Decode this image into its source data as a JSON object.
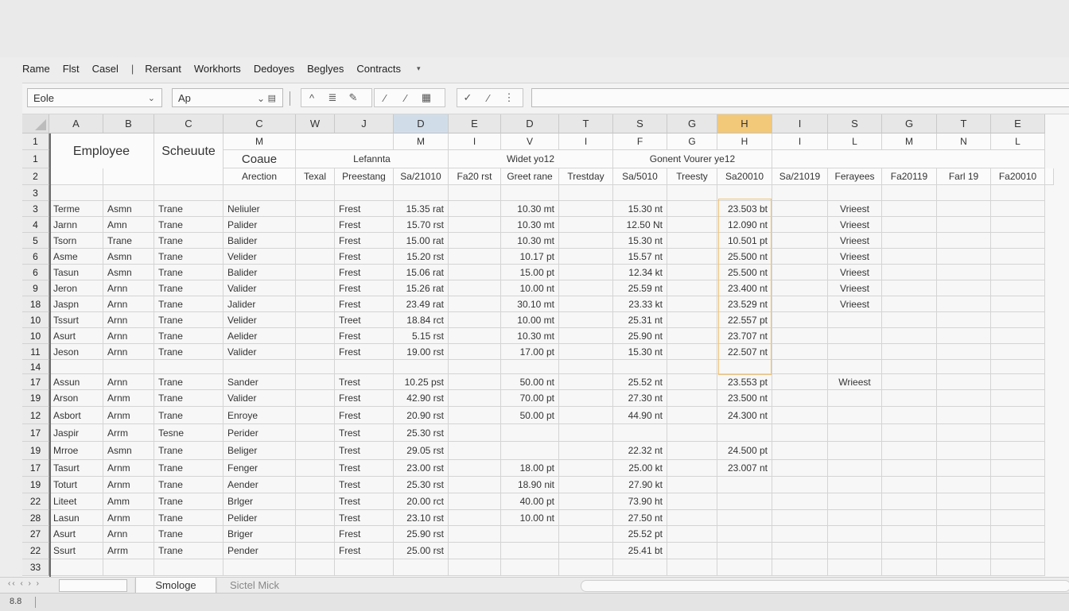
{
  "menu": [
    "Rame",
    "Flst",
    "Casel",
    "|",
    "Rersant",
    "Workhorts",
    "Dedoyes",
    "Beglyes",
    "Contracts"
  ],
  "toolbar": {
    "name_box": "Eole",
    "font_box": "Ap",
    "group1": [
      "^",
      "≣",
      "✎"
    ],
    "group2": [
      "⁄",
      "⁄",
      "▦"
    ],
    "group3": [
      "✓",
      "⁄",
      "⋮"
    ]
  },
  "columns": [
    {
      "label": "A",
      "w": 68
    },
    {
      "label": "B",
      "w": 64
    },
    {
      "label": "C",
      "w": 87
    },
    {
      "label": "C",
      "w": 91
    },
    {
      "label": "W",
      "w": 49
    },
    {
      "label": "J",
      "w": 74
    },
    {
      "label": "D",
      "w": 69
    },
    {
      "label": "E",
      "w": 66
    },
    {
      "label": "D",
      "w": 73
    },
    {
      "label": "T",
      "w": 68
    },
    {
      "label": "S",
      "w": 68
    },
    {
      "label": "G",
      "w": 63
    },
    {
      "label": "H",
      "w": 69
    },
    {
      "label": "I",
      "w": 70
    },
    {
      "label": "S",
      "w": 68
    },
    {
      "label": "G",
      "w": 69
    },
    {
      "label": "T",
      "w": 68
    },
    {
      "label": "E",
      "w": 68
    }
  ],
  "row_numbers": [
    "1",
    "1",
    "2",
    "3",
    "3",
    "4",
    "5",
    "6",
    "6",
    "9",
    "18",
    "10",
    "10",
    "11",
    "14",
    "17",
    "19",
    "12",
    "17",
    "19",
    "17",
    "19",
    "22",
    "28",
    "27",
    "22",
    "33"
  ],
  "header": {
    "row1": {
      "d": "M",
      "g": "M",
      "j": "I",
      "k": "V",
      "l": "I",
      "m": "F",
      "n": "G",
      "o": "H",
      "p": "I",
      "q": "L",
      "r": "M",
      "s": "N",
      "t": "L"
    },
    "employee": "Employee",
    "scheuute": "Scheuute",
    "coaue": "Coaue",
    "lefannta": "Lefannta",
    "widet": "Widet yo12",
    "gonent": "Gonent Vourer ye12",
    "row2": {
      "d": "Arection",
      "e": "Texal",
      "f": "Preestang",
      "g": "Sa/21010",
      "h": "Fa20 rst",
      "i": "Greet rane",
      "j": "Trestday",
      "k": "Sa/5010",
      "l": "Treesty",
      "m": "Sa20010",
      "n": "Sa/21019",
      "o": "Ferayees",
      "p": "Fa20119",
      "q": "Farl 19",
      "r": "Fa20010"
    }
  },
  "rows": [
    [
      "Terme",
      "Asmn",
      "Trane",
      "Neliuler",
      "",
      "Frest",
      "15.35 rat",
      "",
      "10.30 mt",
      "",
      "15.30 nt",
      "",
      "23.503 bt",
      "",
      "Vrieest"
    ],
    [
      "Jarnn",
      "Amn",
      "Trane",
      "Palider",
      "",
      "Frest",
      "15.70 rst",
      "",
      "10.30 mt",
      "",
      "12.50 Nt",
      "",
      "12.090 nt",
      "",
      "Vrieest"
    ],
    [
      "Tsorn",
      "Trane",
      "Trane",
      "Balider",
      "",
      "Frest",
      "15.00 rat",
      "",
      "10.30 mt",
      "",
      "15.30 nt",
      "",
      "10.501 pt",
      "",
      "Vrieest"
    ],
    [
      "Asme",
      "Asmn",
      "Trane",
      "Velider",
      "",
      "Frest",
      "15.20 rst",
      "",
      "10.17 pt",
      "",
      "15.57 nt",
      "",
      "25.500 nt",
      "",
      "Vrieest"
    ],
    [
      "Tasun",
      "Asmn",
      "Trane",
      "Balider",
      "",
      "Frest",
      "15.06 rat",
      "",
      "15.00 pt",
      "",
      "12.34 kt",
      "",
      "25.500 nt",
      "",
      "Vrieest"
    ],
    [
      "Jeron",
      "Arnn",
      "Trane",
      "Valider",
      "",
      "Frest",
      "15.26 rat",
      "",
      "10.00 nt",
      "",
      "25.59 nt",
      "",
      "23.400 nt",
      "",
      "Vrieest"
    ],
    [
      "Jaspn",
      "Arnn",
      "Trane",
      "Jalider",
      "",
      "Frest",
      "23.49 rat",
      "",
      "30.10 mt",
      "",
      "23.33 kt",
      "",
      "23.529 nt",
      "",
      "Vrieest"
    ],
    [
      "Tssurt",
      "Arnn",
      "Trane",
      "Velider",
      "",
      "Treet",
      "18.84 rct",
      "",
      "10.00 mt",
      "",
      "25.31 nt",
      "",
      "22.557 pt",
      "",
      ""
    ],
    [
      "Asurt",
      "Arnn",
      "Trane",
      "Aelider",
      "",
      "Frest",
      "5.15 rst",
      "",
      "10.30 mt",
      "",
      "25.90 nt",
      "",
      "23.707 nt",
      "",
      ""
    ],
    [
      "Jeson",
      "Arnn",
      "Trane",
      "Valider",
      "",
      "Frest",
      "19.00 rst",
      "",
      "17.00 pt",
      "",
      "15.30 nt",
      "",
      "22.507 nt",
      "",
      ""
    ],
    [
      "",
      "",
      "",
      "",
      "",
      "",
      "",
      "",
      "",
      "",
      "",
      "",
      "",
      "",
      ""
    ],
    [
      "Assun",
      "Arnn",
      "Trane",
      "Sander",
      "",
      "Trest",
      "10.25 pst",
      "",
      "50.00 nt",
      "",
      "25.52 nt",
      "",
      "23.553 pt",
      "",
      "Wrieest"
    ],
    [
      "Arson",
      "Arnm",
      "Trane",
      "Valider",
      "",
      "Frest",
      "42.90 rst",
      "",
      "70.00 pt",
      "",
      "27.30 nt",
      "",
      "23.500 nt",
      "",
      ""
    ],
    [
      "Asbort",
      "Arnm",
      "Trane",
      "Enroye",
      "",
      "Frest",
      "20.90 rst",
      "",
      "50.00 pt",
      "",
      "44.90 nt",
      "",
      "24.300 nt",
      "",
      ""
    ],
    [
      "Jaspir",
      "Arrm",
      "Tesne",
      "Perider",
      "",
      "Trest",
      "25.30 rst",
      "",
      "",
      "",
      "",
      "",
      "",
      "",
      ""
    ],
    [
      "Mrroe",
      "Asmn",
      "Trane",
      "Beliger",
      "",
      "Trest",
      "29.05 rst",
      "",
      "",
      "",
      "22.32 nt",
      "",
      "24.500 pt",
      "",
      ""
    ],
    [
      "Tasurt",
      "Arnm",
      "Trane",
      "Fenger",
      "",
      "Trest",
      "23.00 rst",
      "",
      "18.00 pt",
      "",
      "25.00 kt",
      "",
      "23.007 nt",
      "",
      ""
    ],
    [
      "Toturt",
      "Arnm",
      "Trane",
      "Aender",
      "",
      "Trest",
      "25.30 rst",
      "",
      "18.90 nit",
      "",
      "27.90 kt",
      "",
      "",
      "",
      ""
    ],
    [
      "Liteet",
      "Amm",
      "Trane",
      "Brlger",
      "",
      "Trest",
      "20.00 rct",
      "",
      "40.00 pt",
      "",
      "73.90 ht",
      "",
      "",
      "",
      ""
    ],
    [
      "Lasun",
      "Arnm",
      "Trane",
      "Pelider",
      "",
      "Trest",
      "23.10 rst",
      "",
      "10.00 nt",
      "",
      "27.50 nt",
      "",
      "",
      "",
      ""
    ],
    [
      "Asurt",
      "Arnn",
      "Trane",
      "Briger",
      "",
      "Frest",
      "25.90 rst",
      "",
      "",
      "",
      "25.52 pt",
      "",
      "",
      "",
      ""
    ],
    [
      "Ssurt",
      "Arrm",
      "Trane",
      "Pender",
      "",
      "Frest",
      "25.00 rst",
      "",
      "",
      "",
      "25.41 bt",
      "",
      "",
      "",
      ""
    ]
  ],
  "tabs": {
    "nav": "‹‹ ‹ › ›",
    "active": "Smologe",
    "other": "Sictel Mick"
  },
  "status": "8.8"
}
